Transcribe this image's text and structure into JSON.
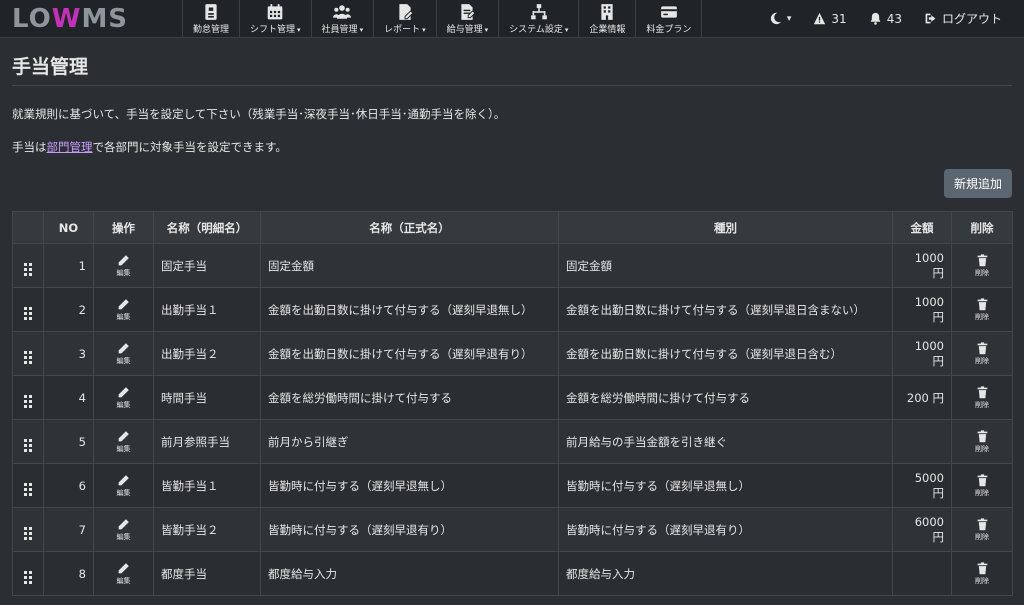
{
  "brand": {
    "logo_left": "LO",
    "logo_mid": "W",
    "logo_right": "MS"
  },
  "nav": [
    {
      "label": "勤怠管理",
      "icon": "badge-icon",
      "caret": false
    },
    {
      "label": "シフト管理",
      "icon": "calendar-icon",
      "caret": true
    },
    {
      "label": "社員管理",
      "icon": "users-icon",
      "caret": true
    },
    {
      "label": "レポート",
      "icon": "report-icon",
      "caret": true
    },
    {
      "label": "給与管理",
      "icon": "payroll-icon",
      "caret": true
    },
    {
      "label": "システム設定",
      "icon": "sitemap-icon",
      "caret": true
    },
    {
      "label": "企業情報",
      "icon": "building-icon",
      "caret": false
    },
    {
      "label": "料金プラン",
      "icon": "credit-card-icon",
      "caret": false
    }
  ],
  "header_right": {
    "theme_caret": "▾",
    "alerts_count": "31",
    "notifications_count": "43",
    "logout_label": "ログアウト"
  },
  "page": {
    "title": "手当管理",
    "description": "就業規則に基づいて、手当を設定して下さい（残業手当･深夜手当･休日手当･通勤手当を除く）。",
    "desc2_prefix": "手当は",
    "desc2_link": "部門管理",
    "desc2_suffix": "で各部門に対象手当を設定できます。",
    "add_button": "新規追加"
  },
  "table": {
    "headers": {
      "no": "NO",
      "action": "操作",
      "short_name": "名称（明細名）",
      "formal_name": "名称（正式名）",
      "type": "種別",
      "amount": "金額",
      "delete": "削除"
    },
    "edit_label": "編集",
    "delete_label": "削除",
    "rows": [
      {
        "no": "1",
        "short_name": "固定手当",
        "formal_name": "固定金額",
        "type": "固定金額",
        "amount": "1000 円"
      },
      {
        "no": "2",
        "short_name": "出勤手当１",
        "formal_name": "金額を出勤日数に掛けて付与する（遅刻早退無し）",
        "type": "金額を出勤日数に掛けて付与する（遅刻早退日含まない）",
        "amount": "1000 円"
      },
      {
        "no": "3",
        "short_name": "出勤手当２",
        "formal_name": "金額を出勤日数に掛けて付与する（遅刻早退有り）",
        "type": "金額を出勤日数に掛けて付与する（遅刻早退日含む）",
        "amount": "1000 円"
      },
      {
        "no": "4",
        "short_name": "時間手当",
        "formal_name": "金額を総労働時間に掛けて付与する",
        "type": "金額を総労働時間に掛けて付与する",
        "amount": "200 円"
      },
      {
        "no": "5",
        "short_name": "前月参照手当",
        "formal_name": "前月から引継ぎ",
        "type": "前月給与の手当金額を引き継ぐ",
        "amount": ""
      },
      {
        "no": "6",
        "short_name": "皆勤手当１",
        "formal_name": "皆勤時に付与する（遅刻早退無し）",
        "type": "皆勤時に付与する（遅刻早退無し）",
        "amount": "5000 円"
      },
      {
        "no": "7",
        "short_name": "皆勤手当２",
        "formal_name": "皆勤時に付与する（遅刻早退有り）",
        "type": "皆勤時に付与する（遅刻早退有り）",
        "amount": "6000 円"
      },
      {
        "no": "8",
        "short_name": "都度手当",
        "formal_name": "都度給与入力",
        "type": "都度給与入力",
        "amount": ""
      }
    ]
  }
}
